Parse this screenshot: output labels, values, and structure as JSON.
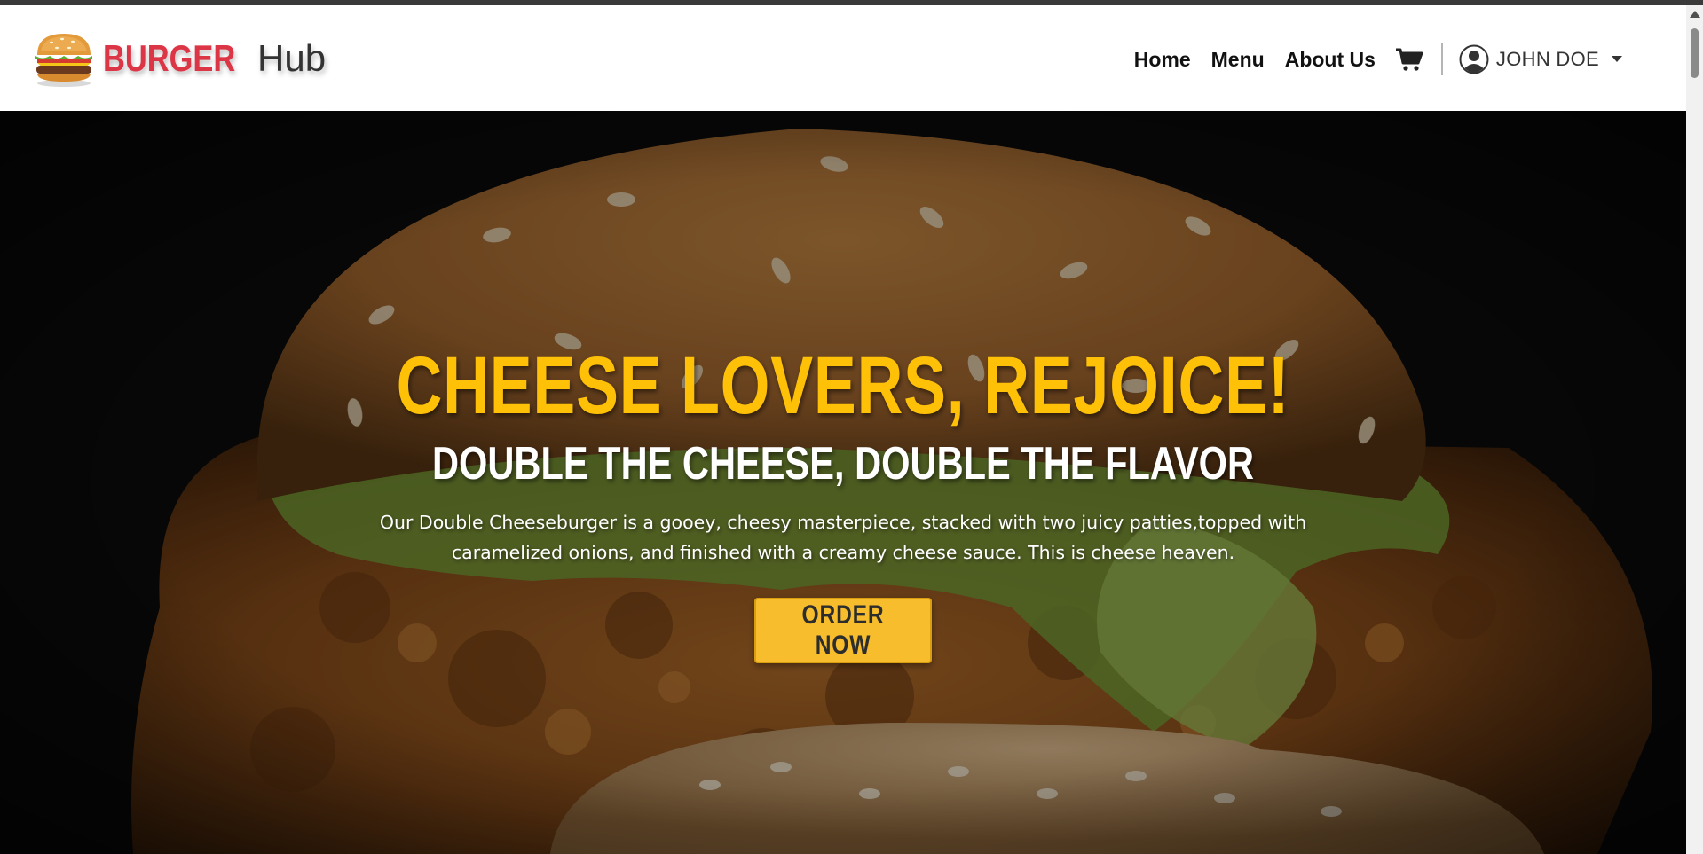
{
  "brand": {
    "name_part1": "BURGER",
    "name_part2": "Hub",
    "logo_icon": "burger-logo-icon"
  },
  "nav": {
    "links": [
      {
        "label": "Home"
      },
      {
        "label": "Menu"
      },
      {
        "label": "About Us"
      }
    ],
    "cart_icon": "cart-icon",
    "user": {
      "name": "JOHN DOE",
      "icon": "user-circle-icon",
      "dropdown_icon": "caret-down-icon"
    }
  },
  "hero": {
    "title": "CHEESE LOVERS, REJOICE!",
    "subtitle": "DOUBLE THE CHEESE, DOUBLE THE FLAVOR",
    "description": "Our Double Cheeseburger is a gooey, cheesy masterpiece, stacked with two juicy patties,topped with caramelized onions, and finished with a creamy cheese sauce. This is cheese heaven.",
    "cta_label": "ORDER NOW",
    "background_image": "fried-chicken-burger-photo"
  },
  "colors": {
    "brand_red": "#dc3545",
    "accent_yellow": "#ffc107",
    "button_yellow": "#f7bd2c",
    "navbar_bg": "#ffffff"
  }
}
